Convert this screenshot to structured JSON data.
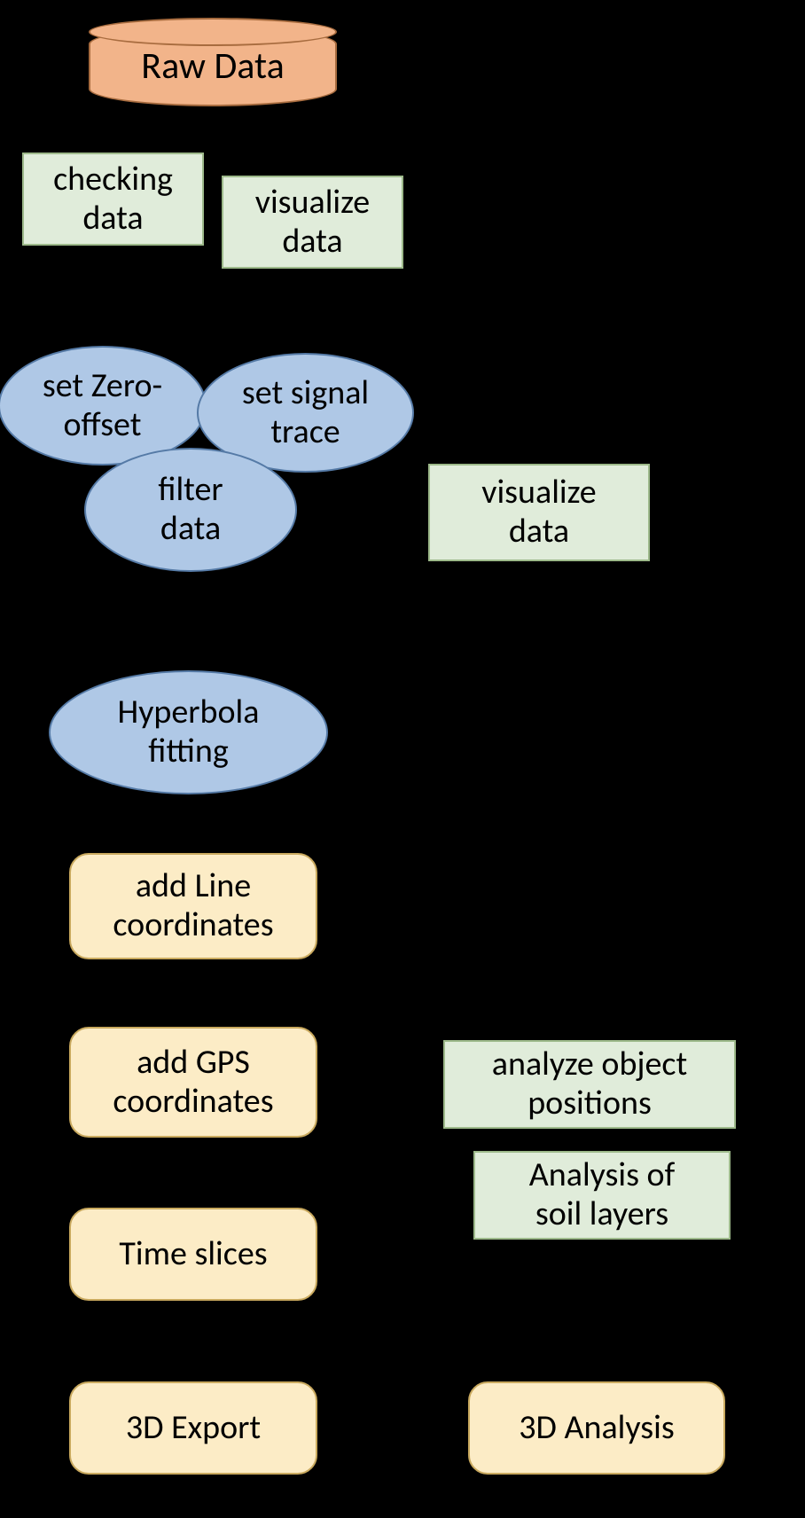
{
  "nodes": {
    "raw_data": "Raw Data",
    "checking_data": "checking\ndata",
    "visualize_data_1": "visualize\ndata",
    "set_zero_offset": "set Zero-\noffset",
    "set_signal_trace": "set signal\ntrace",
    "filter_data": "filter\ndata",
    "visualize_data_2": "visualize\ndata",
    "hyperbola_fitting": "Hyperbola\nfitting",
    "add_line_coords": "add Line\ncoordinates",
    "add_gps_coords": "add GPS\ncoordinates",
    "analyze_object_positions": "analyze object\npositions",
    "time_slices": "Time slices",
    "analysis_soil_layers": "Analysis of\nsoil layers",
    "export_3d": "3D Export",
    "analysis_3d": "3D Analysis"
  },
  "chart_data": {
    "type": "flowchart",
    "nodes": [
      {
        "id": "raw_data",
        "shape": "cylinder",
        "label": "Raw Data"
      },
      {
        "id": "checking_data",
        "shape": "rect",
        "color": "green",
        "label": "checking data"
      },
      {
        "id": "visualize_data_1",
        "shape": "rect",
        "color": "green",
        "label": "visualize data"
      },
      {
        "id": "set_zero_offset",
        "shape": "ellipse",
        "color": "blue",
        "label": "set Zero-offset"
      },
      {
        "id": "set_signal_trace",
        "shape": "ellipse",
        "color": "blue",
        "label": "set signal trace"
      },
      {
        "id": "filter_data",
        "shape": "ellipse",
        "color": "blue",
        "label": "filter data"
      },
      {
        "id": "visualize_data_2",
        "shape": "rect",
        "color": "green",
        "label": "visualize data"
      },
      {
        "id": "hyperbola_fitting",
        "shape": "ellipse",
        "color": "blue",
        "label": "Hyperbola fitting"
      },
      {
        "id": "add_line_coords",
        "shape": "rrect",
        "color": "yellow",
        "label": "add Line coordinates"
      },
      {
        "id": "add_gps_coords",
        "shape": "rrect",
        "color": "yellow",
        "label": "add GPS coordinates"
      },
      {
        "id": "analyze_object_positions",
        "shape": "rect",
        "color": "green",
        "label": "analyze object positions"
      },
      {
        "id": "time_slices",
        "shape": "rrect",
        "color": "yellow",
        "label": "Time slices"
      },
      {
        "id": "analysis_soil_layers",
        "shape": "rect",
        "color": "green",
        "label": "Analysis of soil layers"
      },
      {
        "id": "export_3d",
        "shape": "rrect",
        "color": "yellow",
        "label": "3D Export"
      },
      {
        "id": "analysis_3d",
        "shape": "rrect",
        "color": "yellow",
        "label": "3D Analysis"
      }
    ],
    "edges": [
      {
        "from": "raw_data",
        "to": "checking_data"
      },
      {
        "from": "checking_data",
        "to": "visualize_data_1"
      },
      {
        "from": "checking_data",
        "to": "set_zero_offset"
      },
      {
        "from": "set_zero_offset",
        "to": "set_signal_trace"
      },
      {
        "from": "set_signal_trace",
        "to": "filter_data"
      },
      {
        "from": "filter_data",
        "to": "visualize_data_2"
      },
      {
        "from": "filter_data",
        "to": "hyperbola_fitting"
      },
      {
        "from": "hyperbola_fitting",
        "to": "add_line_coords"
      },
      {
        "from": "add_line_coords",
        "to": "add_gps_coords"
      },
      {
        "from": "add_gps_coords",
        "to": "analyze_object_positions"
      },
      {
        "from": "add_gps_coords",
        "to": "time_slices"
      },
      {
        "from": "time_slices",
        "to": "analysis_soil_layers"
      },
      {
        "from": "time_slices",
        "to": "export_3d"
      },
      {
        "from": "export_3d",
        "to": "analysis_3d"
      }
    ]
  }
}
